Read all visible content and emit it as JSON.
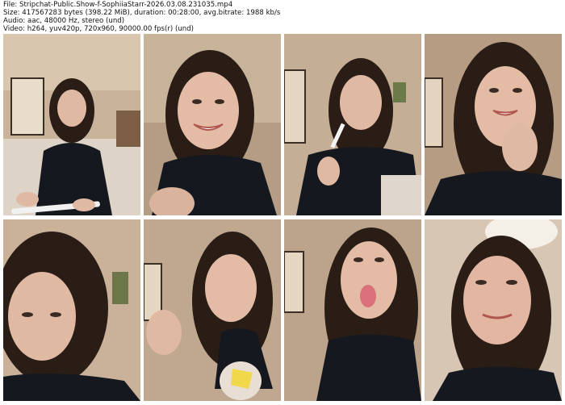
{
  "header": {
    "file_line": "File: Stripchat-Public.Show-f-SophiiaStarr-2026.03.08.231035.mp4",
    "size_line": "Size: 417567283 bytes (398.22 MiB), duration: 00:28:00, avg.bitrate: 1988 kb/s",
    "audio_line": "Audio: aac, 48000 Hz, stereo (und)",
    "video_line": "Video: h264, yuv420p, 720x960, 90000.00 fps(r) (und)"
  },
  "frames": [
    {
      "scene": "sitting-on-couch-holding-phone"
    },
    {
      "scene": "smiling-close-up"
    },
    {
      "scene": "holding-white-stick"
    },
    {
      "scene": "smiling-hand-to-face"
    },
    {
      "scene": "looking-down-close-up"
    },
    {
      "scene": "holding-yellow-object"
    },
    {
      "scene": "tongue-out"
    },
    {
      "scene": "low-angle-close-up"
    }
  ],
  "colors": {
    "wall": "#cdb8a0",
    "hair": "#2a1d16",
    "skin": "#e0b9a3",
    "sweater": "#16181f"
  }
}
